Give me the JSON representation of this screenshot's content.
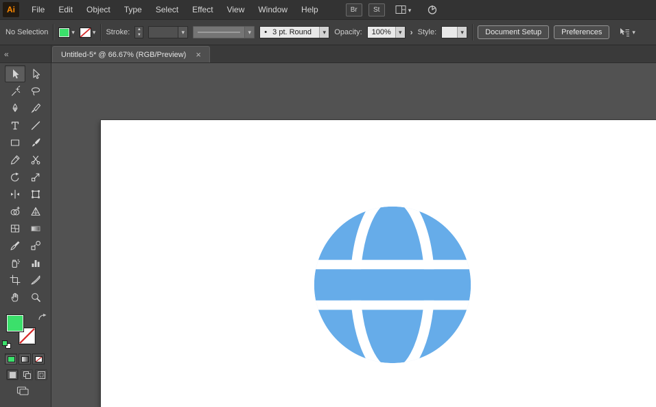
{
  "menubar": {
    "logo": "Ai",
    "items": [
      "File",
      "Edit",
      "Object",
      "Type",
      "Select",
      "Effect",
      "View",
      "Window",
      "Help"
    ],
    "br": "Br",
    "st": "St"
  },
  "control_bar": {
    "selection_status": "No Selection",
    "stroke_label": "Stroke:",
    "brush_bullet": "•",
    "brush_style": "3 pt. Round",
    "opacity_label": "Opacity:",
    "opacity_value": "100%",
    "style_label": "Style:",
    "document_setup_label": "Document Setup",
    "preferences_label": "Preferences"
  },
  "document_tab": {
    "title": "Untitled-5* @ 66.67% (RGB/Preview)",
    "close": "×"
  },
  "toolbar": {
    "collapse": "«",
    "tools": [
      "selection-tool",
      "direct-selection-tool",
      "magic-wand-tool",
      "lasso-tool",
      "pen-tool",
      "brush-pen-tool",
      "type-tool",
      "line-segment-tool",
      "rectangle-tool",
      "paintbrush-tool",
      "pencil-tool",
      "scissors-tool",
      "rotate-tool",
      "scale-tool",
      "width-tool",
      "free-transform-tool",
      "shape-builder-tool",
      "perspective-grid-tool",
      "mesh-tool",
      "gradient-tool",
      "eyedropper-tool",
      "blend-tool",
      "symbol-sprayer-tool",
      "column-graph-tool",
      "artboard-tool",
      "slice-tool",
      "hand-tool",
      "zoom-tool"
    ]
  },
  "colors": {
    "fill_green": "#3BE06B",
    "none_red": "#D62B2B",
    "globe_blue": "#66ACE9",
    "artboard_white": "#FFFFFF"
  }
}
